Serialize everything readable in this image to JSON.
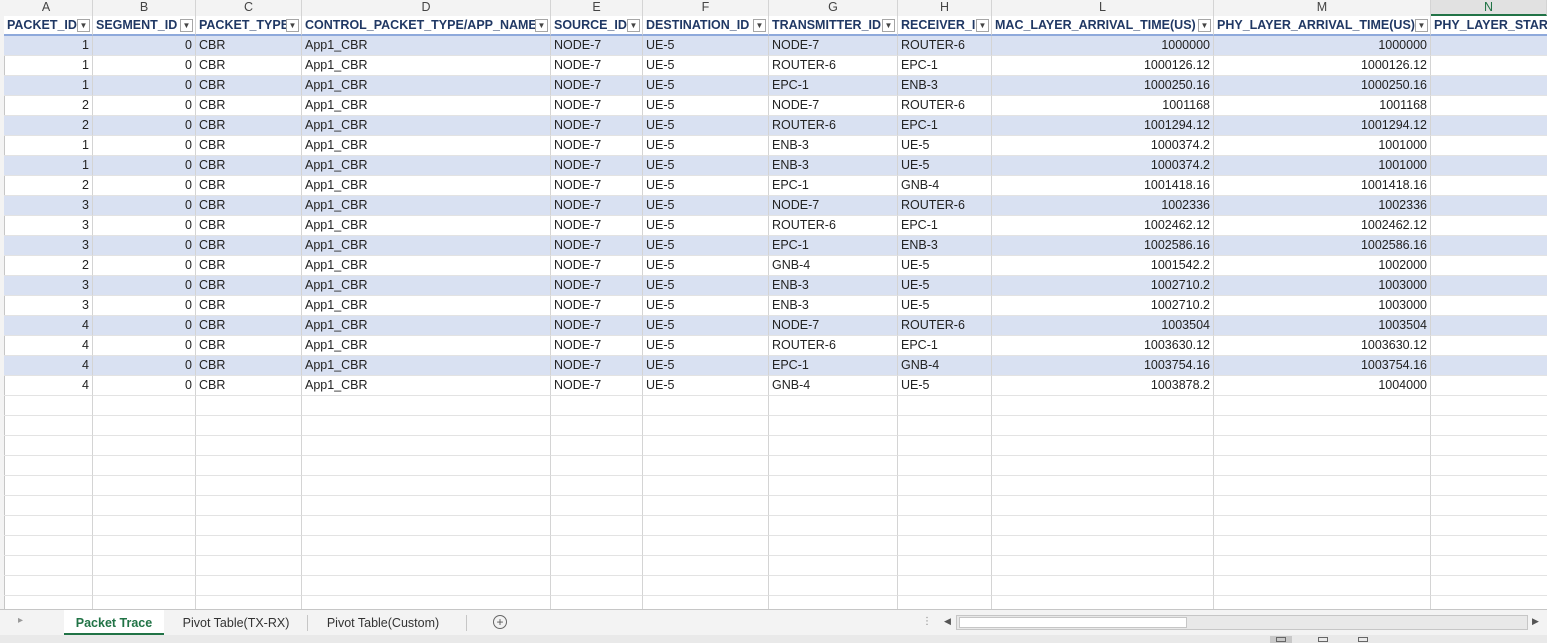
{
  "columns": [
    {
      "letter": "A",
      "header": "PACKET_ID",
      "filtered": true
    },
    {
      "letter": "B",
      "header": "SEGMENT_ID",
      "filtered": false
    },
    {
      "letter": "C",
      "header": "PACKET_TYPE",
      "filtered": false
    },
    {
      "letter": "D",
      "header": "CONTROL_PACKET_TYPE/APP_NAME",
      "filtered": true
    },
    {
      "letter": "E",
      "header": "SOURCE_ID",
      "filtered": false
    },
    {
      "letter": "F",
      "header": "DESTINATION_ID",
      "filtered": false
    },
    {
      "letter": "G",
      "header": "TRANSMITTER_ID",
      "filtered": false
    },
    {
      "letter": "H",
      "header": "RECEIVER_ID",
      "filtered": false
    },
    {
      "letter": "L",
      "header": "MAC_LAYER_ARRIVAL_TIME(US)",
      "filtered": false
    },
    {
      "letter": "M",
      "header": "PHY_LAYER_ARRIVAL_TIME(US)",
      "filtered": false
    },
    {
      "letter": "N",
      "header": "PHY_LAYER_START",
      "filtered": false
    }
  ],
  "rows": [
    [
      "1",
      "0",
      "CBR",
      "App1_CBR",
      "NODE-7",
      "UE-5",
      "NODE-7",
      "ROUTER-6",
      "1000000",
      "1000000",
      ""
    ],
    [
      "1",
      "0",
      "CBR",
      "App1_CBR",
      "NODE-7",
      "UE-5",
      "ROUTER-6",
      "EPC-1",
      "1000126.12",
      "1000126.12",
      ""
    ],
    [
      "1",
      "0",
      "CBR",
      "App1_CBR",
      "NODE-7",
      "UE-5",
      "EPC-1",
      "ENB-3",
      "1000250.16",
      "1000250.16",
      ""
    ],
    [
      "2",
      "0",
      "CBR",
      "App1_CBR",
      "NODE-7",
      "UE-5",
      "NODE-7",
      "ROUTER-6",
      "1001168",
      "1001168",
      ""
    ],
    [
      "2",
      "0",
      "CBR",
      "App1_CBR",
      "NODE-7",
      "UE-5",
      "ROUTER-6",
      "EPC-1",
      "1001294.12",
      "1001294.12",
      ""
    ],
    [
      "1",
      "0",
      "CBR",
      "App1_CBR",
      "NODE-7",
      "UE-5",
      "ENB-3",
      "UE-5",
      "1000374.2",
      "1001000",
      ""
    ],
    [
      "1",
      "0",
      "CBR",
      "App1_CBR",
      "NODE-7",
      "UE-5",
      "ENB-3",
      "UE-5",
      "1000374.2",
      "1001000",
      ""
    ],
    [
      "2",
      "0",
      "CBR",
      "App1_CBR",
      "NODE-7",
      "UE-5",
      "EPC-1",
      "GNB-4",
      "1001418.16",
      "1001418.16",
      ""
    ],
    [
      "3",
      "0",
      "CBR",
      "App1_CBR",
      "NODE-7",
      "UE-5",
      "NODE-7",
      "ROUTER-6",
      "1002336",
      "1002336",
      ""
    ],
    [
      "3",
      "0",
      "CBR",
      "App1_CBR",
      "NODE-7",
      "UE-5",
      "ROUTER-6",
      "EPC-1",
      "1002462.12",
      "1002462.12",
      ""
    ],
    [
      "3",
      "0",
      "CBR",
      "App1_CBR",
      "NODE-7",
      "UE-5",
      "EPC-1",
      "ENB-3",
      "1002586.16",
      "1002586.16",
      ""
    ],
    [
      "2",
      "0",
      "CBR",
      "App1_CBR",
      "NODE-7",
      "UE-5",
      "GNB-4",
      "UE-5",
      "1001542.2",
      "1002000",
      ""
    ],
    [
      "3",
      "0",
      "CBR",
      "App1_CBR",
      "NODE-7",
      "UE-5",
      "ENB-3",
      "UE-5",
      "1002710.2",
      "1003000",
      ""
    ],
    [
      "3",
      "0",
      "CBR",
      "App1_CBR",
      "NODE-7",
      "UE-5",
      "ENB-3",
      "UE-5",
      "1002710.2",
      "1003000",
      ""
    ],
    [
      "4",
      "0",
      "CBR",
      "App1_CBR",
      "NODE-7",
      "UE-5",
      "NODE-7",
      "ROUTER-6",
      "1003504",
      "1003504",
      ""
    ],
    [
      "4",
      "0",
      "CBR",
      "App1_CBR",
      "NODE-7",
      "UE-5",
      "ROUTER-6",
      "EPC-1",
      "1003630.12",
      "1003630.12",
      ""
    ],
    [
      "4",
      "0",
      "CBR",
      "App1_CBR",
      "NODE-7",
      "UE-5",
      "EPC-1",
      "GNB-4",
      "1003754.16",
      "1003754.16",
      ""
    ],
    [
      "4",
      "0",
      "CBR",
      "App1_CBR",
      "NODE-7",
      "UE-5",
      "GNB-4",
      "UE-5",
      "1003878.2",
      "1004000",
      ""
    ]
  ],
  "sheet_tabs": {
    "packet_trace": "Packet Trace",
    "pivot_tx_rx": "Pivot Table(TX-RX)",
    "pivot_custom": "Pivot Table(Custom)"
  },
  "icons": {
    "filter": "filter-funnel-icon",
    "dropdown": "dropdown-arrow-icon",
    "add_sheet": "plus-circle-icon"
  },
  "colors": {
    "band": "#d9e1f2",
    "header_text": "#203864",
    "accent": "#217346"
  }
}
